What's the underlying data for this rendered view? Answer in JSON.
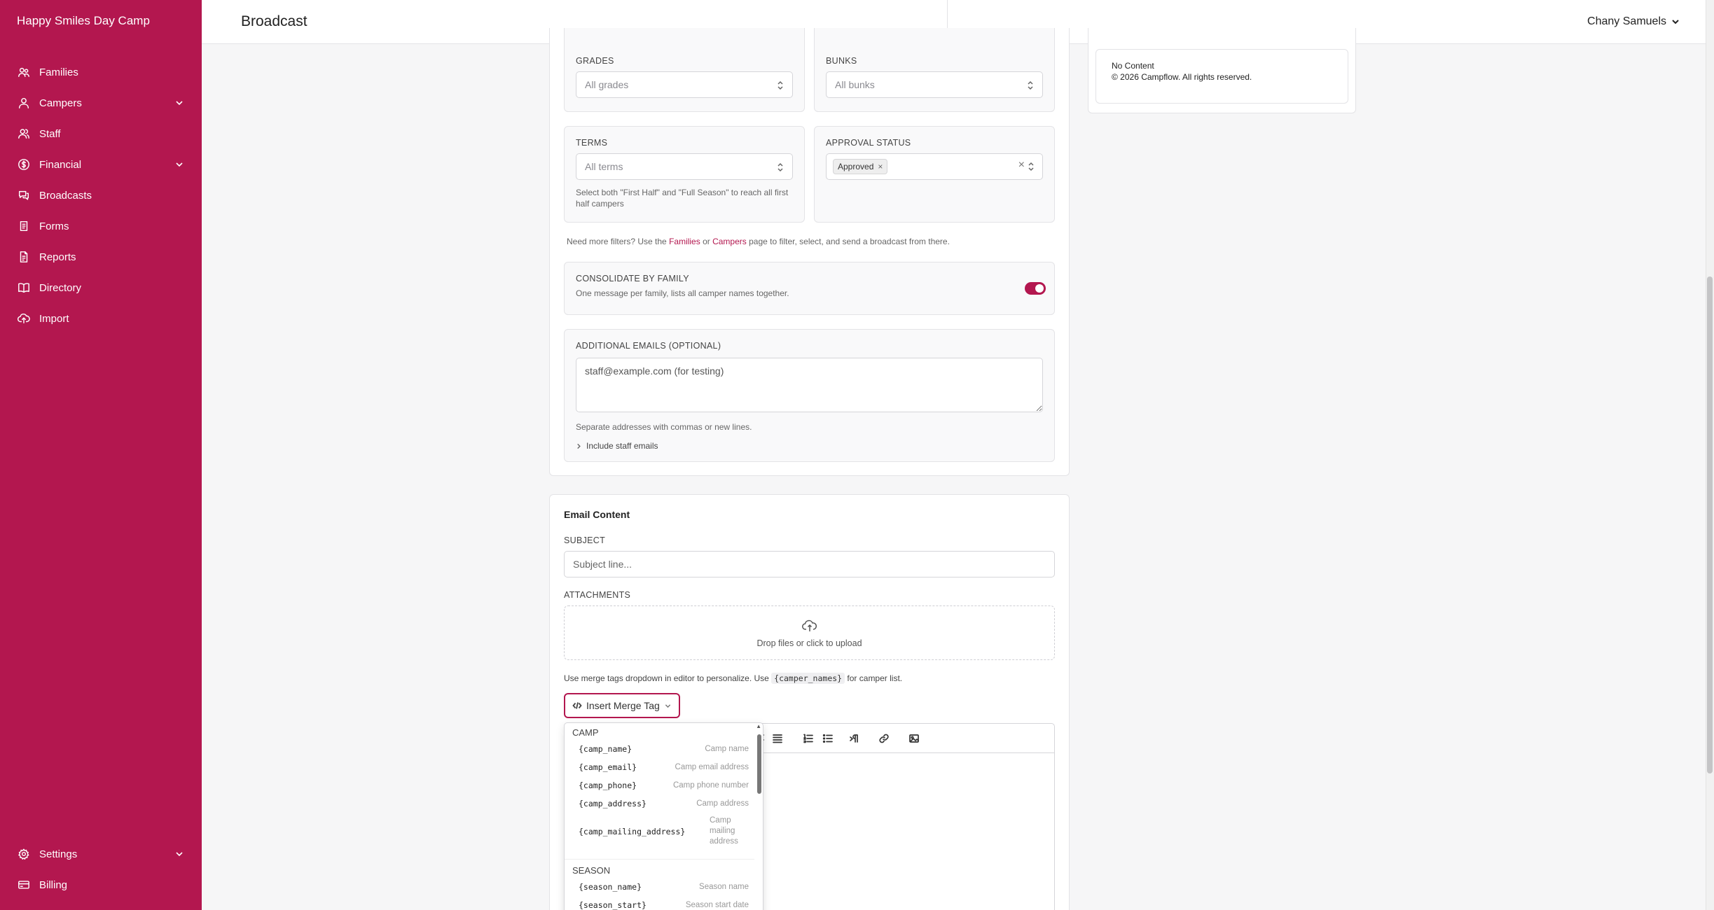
{
  "app": {
    "name": "Happy Smiles Day Camp"
  },
  "header": {
    "title": "Broadcast",
    "user": "Chany Samuels"
  },
  "sidebar": {
    "items": [
      {
        "label": "Families",
        "icon": "families-icon"
      },
      {
        "label": "Campers",
        "icon": "campers-icon",
        "expandable": true
      },
      {
        "label": "Staff",
        "icon": "staff-icon"
      },
      {
        "label": "Financial",
        "icon": "financial-icon",
        "expandable": true
      },
      {
        "label": "Broadcasts",
        "icon": "broadcasts-icon"
      },
      {
        "label": "Forms",
        "icon": "forms-icon"
      },
      {
        "label": "Reports",
        "icon": "reports-icon"
      },
      {
        "label": "Directory",
        "icon": "directory-icon"
      },
      {
        "label": "Import",
        "icon": "import-icon"
      }
    ],
    "bottom": [
      {
        "label": "Settings",
        "icon": "settings-icon",
        "expandable": true
      },
      {
        "label": "Billing",
        "icon": "billing-icon"
      }
    ]
  },
  "filters": {
    "grades": {
      "label": "GRADES",
      "placeholder": "All grades"
    },
    "bunks": {
      "label": "BUNKS",
      "placeholder": "All bunks"
    },
    "terms": {
      "label": "TERMS",
      "placeholder": "All terms",
      "hint": "Select both \"First Half\" and \"Full Season\" to reach all first half campers"
    },
    "approval": {
      "label": "APPROVAL STATUS",
      "chip": "Approved",
      "chip_remove": "×",
      "clear": "×"
    },
    "more_hint": {
      "prefix": "Need more filters? Use the ",
      "link1": "Families",
      "mid": " or ",
      "link2": "Campers",
      "suffix": " page to filter, select, and send a broadcast from there."
    }
  },
  "consolidate": {
    "label": "CONSOLIDATE BY FAMILY",
    "desc": "One message per family, lists all camper names together.",
    "enabled": true
  },
  "additional_emails": {
    "label": "ADDITIONAL EMAILS (OPTIONAL)",
    "placeholder": "staff@example.com (for testing)",
    "hint": "Separate addresses with commas or new lines.",
    "include_staff": "Include staff emails"
  },
  "email_content": {
    "title": "Email Content",
    "subject_label": "SUBJECT",
    "subject_placeholder": "Subject line...",
    "attachments_label": "ATTACHMENTS",
    "dropzone_text": "Drop files or click to upload",
    "merge_hint_prefix": "Use merge tags dropdown in editor to personalize. Use ",
    "merge_hint_code": "{camper_names}",
    "merge_hint_suffix": " for camper list.",
    "merge_button": "Insert Merge Tag"
  },
  "merge_dropdown": {
    "groups": [
      {
        "name": "CAMP",
        "items": [
          {
            "tag": "{camp_name}",
            "desc": "Camp name"
          },
          {
            "tag": "{camp_email}",
            "desc": "Camp email address"
          },
          {
            "tag": "{camp_phone}",
            "desc": "Camp phone number"
          },
          {
            "tag": "{camp_address}",
            "desc": "Camp address"
          },
          {
            "tag": "{camp_mailing_address}",
            "desc": "Camp mailing address"
          }
        ]
      },
      {
        "name": "SEASON",
        "items": [
          {
            "tag": "{season_name}",
            "desc": "Season name"
          },
          {
            "tag": "{season_start}",
            "desc": "Season start date"
          }
        ]
      }
    ]
  },
  "preview": {
    "line1": "No Content",
    "line2": "© 2026 Campflow. All rights reserved."
  },
  "colors": {
    "brand": "#b3174f",
    "background": "#f6f6f7"
  }
}
